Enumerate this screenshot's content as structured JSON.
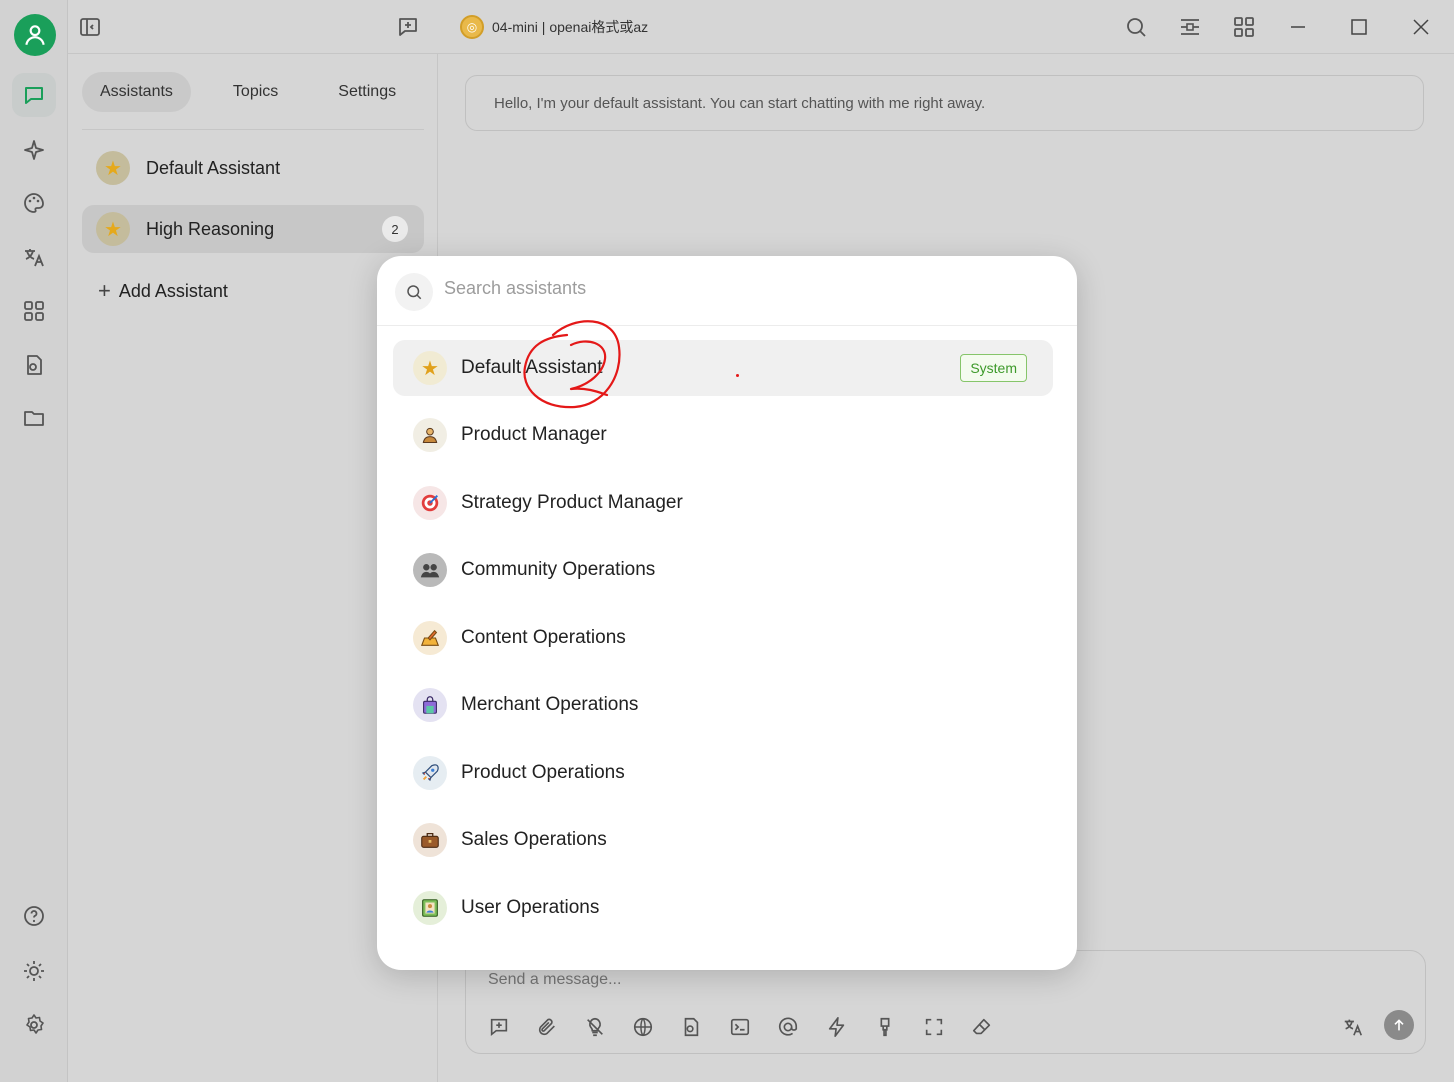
{
  "window": {
    "model_name": "04-mini | openai格式或az"
  },
  "sidebar": {
    "tabs": [
      {
        "label": "Assistants"
      },
      {
        "label": "Topics"
      },
      {
        "label": "Settings"
      }
    ],
    "assistants": [
      {
        "name": "Default Assistant",
        "icon": "star-icon"
      },
      {
        "name": "High Reasoning",
        "icon": "star-icon",
        "count": "2"
      }
    ],
    "add_label": "Add Assistant"
  },
  "main": {
    "greeting": "Hello, I'm your default assistant. You can start chatting with me right away.",
    "composer_placeholder": "Send a message..."
  },
  "popup": {
    "search_placeholder": "Search assistants",
    "items": [
      {
        "name": "Default Assistant",
        "icon": "star-icon",
        "tag": "System"
      },
      {
        "name": "Product Manager",
        "icon": "person-icon"
      },
      {
        "name": "Strategy Product Manager",
        "icon": "target-icon"
      },
      {
        "name": "Community Operations",
        "icon": "group-icon"
      },
      {
        "name": "Content Operations",
        "icon": "writing-icon"
      },
      {
        "name": "Merchant Operations",
        "icon": "shopping-bag-icon"
      },
      {
        "name": "Product Operations",
        "icon": "rocket-icon"
      },
      {
        "name": "Sales Operations",
        "icon": "briefcase-icon"
      },
      {
        "name": "User Operations",
        "icon": "user-card-icon"
      }
    ]
  },
  "colors": {
    "brand_green": "#1a9f5a",
    "system_tag": "#3d9a2a",
    "annotation_red": "#e41818"
  }
}
